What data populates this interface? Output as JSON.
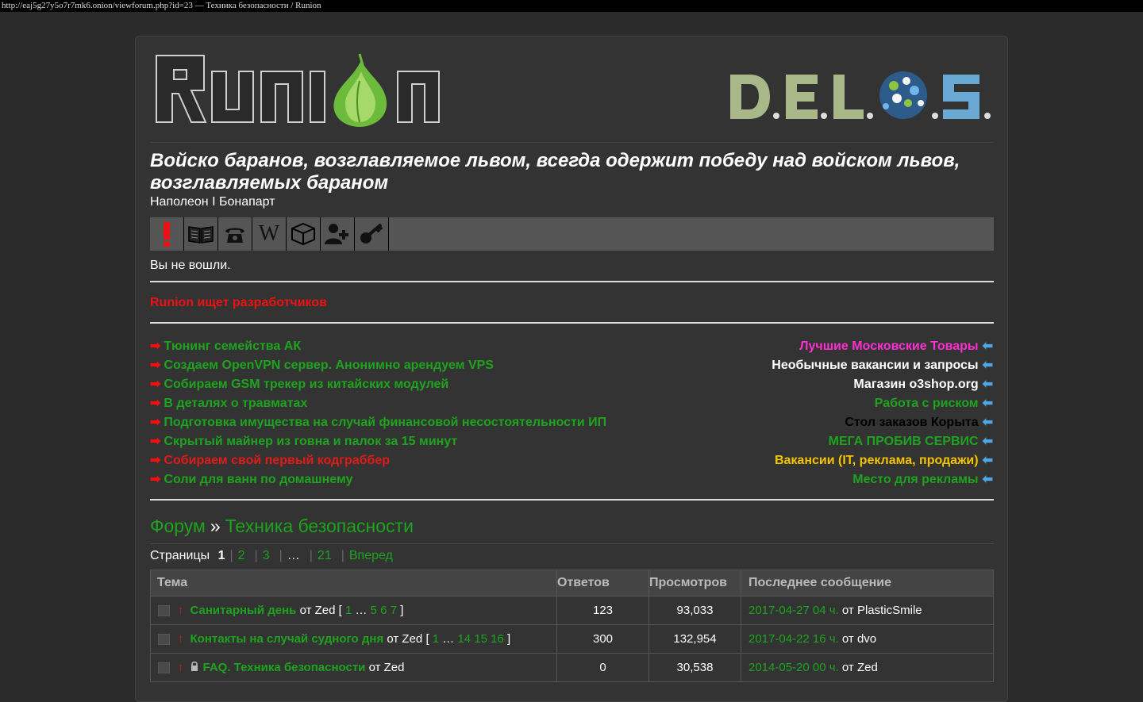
{
  "window": {
    "title": "http://eaj5g27y5o7r7mk6.onion/viewforum.php?id=23 — Техника безопасности / Runion"
  },
  "brand": {
    "logo_text": "Runion",
    "partner_logo_text": "D.E.L.O.S."
  },
  "motto": {
    "quote": "Войско баранов, возглавляемое львом, всегда одержит победу над войском львов, возглавляемых бараном",
    "author": "Наполеон I Бонапарт"
  },
  "toolbar": {
    "icons": [
      "alert-icon",
      "book-icon",
      "phone-icon",
      "wikipedia-icon",
      "package-icon",
      "add-user-icon",
      "key-icon"
    ],
    "wiki_glyph": "W"
  },
  "status": {
    "text": "Вы не вошли."
  },
  "announce": {
    "text": "Runion ищет разработчиков"
  },
  "links_left": [
    {
      "text": "Тюнинг семейства АК",
      "color": "#1ea31e"
    },
    {
      "text": "Создаем OpenVPN сервер. Анонимно арендуем VPS",
      "color": "#1ea31e"
    },
    {
      "text": "Собираем GSM трекер из китайских модулей",
      "color": "#1ea31e"
    },
    {
      "text": "В деталях о травматах",
      "color": "#1ea31e"
    },
    {
      "text": "Подготовка имущества на случай финансовой несостоятельности ИП",
      "color": "#1ea31e"
    },
    {
      "text": "Скрытый майнер из говна и палок за 15 минут",
      "color": "#1ea31e"
    },
    {
      "text": "Собираем свой первый кодграббер",
      "color": "#e11a1a"
    },
    {
      "text": "Соли для ванн по домашнему",
      "color": "#1ea31e"
    }
  ],
  "links_right": [
    {
      "text": "Лучшие Московские Товары",
      "color": "#ff2fd1"
    },
    {
      "text": "Необычные вакансии и запросы",
      "color": "#ffffff"
    },
    {
      "text": "Магазин o3shop.org",
      "color": "#ffffff"
    },
    {
      "text": "Работа с риском",
      "color": "#1ea31e"
    },
    {
      "text": "Стол заказов Корыта",
      "color": "#000000"
    },
    {
      "text": "МЕГА ПРОБИВ СЕРВИС",
      "color": "#1ea31e"
    },
    {
      "text": "Вакансии (IT, реклама, продажи)",
      "color": "#f5c400"
    },
    {
      "text": "Место для рекламы",
      "color": "#1ea31e"
    }
  ],
  "breadcrumb": {
    "root": "Форум",
    "sep": "»",
    "current": "Техника безопасности"
  },
  "pager": {
    "label": "Страницы",
    "current": "1",
    "pages": [
      "2",
      "3"
    ],
    "ellipsis": "…",
    "last": "21",
    "next": "Вперед"
  },
  "table": {
    "headers": {
      "topic": "Тема",
      "replies": "Ответов",
      "views": "Просмотров",
      "last": "Последнее сообщение"
    },
    "rows": [
      {
        "title": "Санитарный день",
        "by": " от Zed ",
        "pages_open": "[ ",
        "p1": "1",
        "dots": " … ",
        "pages": "5 6 7",
        "pages_close": " ]",
        "replies": "123",
        "views": "93,033",
        "last_date": "2017-04-27 04 ч.",
        "last_by": " от PlasticSmile",
        "locked": false
      },
      {
        "title": "Контакты на случай судного дня",
        "by": " от Zed ",
        "pages_open": "[ ",
        "p1": "1",
        "dots": " … ",
        "pages": "14 15 16",
        "pages_close": " ]",
        "replies": "300",
        "views": "132,954",
        "last_date": "2017-04-22 16 ч.",
        "last_by": " от dvo",
        "locked": false
      },
      {
        "title": "FAQ. Техника безопасности",
        "by": " от Zed",
        "pages_open": "",
        "p1": "",
        "dots": "",
        "pages": "",
        "pages_close": "",
        "replies": "0",
        "views": "30,538",
        "last_date": "2014-05-20 00 ч.",
        "last_by": " от Zed",
        "locked": true
      }
    ]
  }
}
